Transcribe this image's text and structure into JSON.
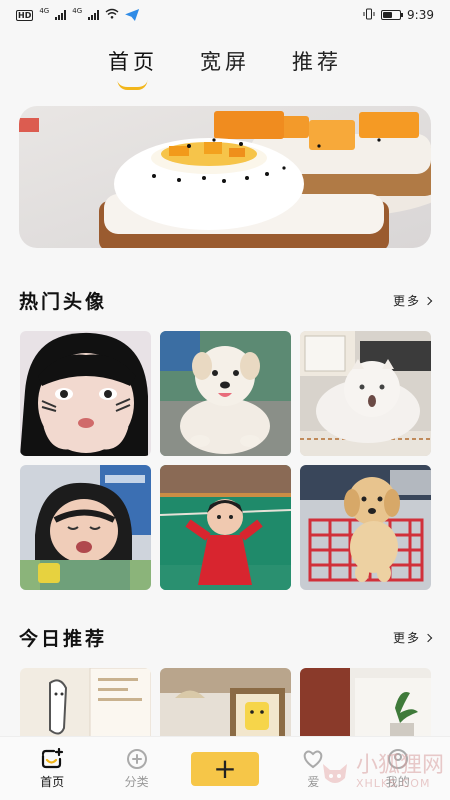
{
  "status_bar": {
    "hd": "HD",
    "net1": "4G",
    "net2": "4G",
    "battery_level": 0.55,
    "time": "9:39"
  },
  "top_tabs": [
    {
      "label": "首页",
      "active": true
    },
    {
      "label": "宽屏",
      "active": false
    },
    {
      "label": "推荐",
      "active": false
    }
  ],
  "sections": {
    "hot": {
      "title": "热门头像",
      "more": "更多"
    },
    "today": {
      "title": "今日推荐",
      "more": "更多"
    }
  },
  "bottom_nav": {
    "home": "首页",
    "category": "分类",
    "add": "+",
    "fourth": "爱",
    "fifth": "我的"
  },
  "watermark": {
    "text": "小狐狸网",
    "sub": "XHLKS.COM"
  },
  "colors": {
    "accent": "#f2b61b",
    "add_button": "#f6c648",
    "background": "#f7f7f7"
  }
}
